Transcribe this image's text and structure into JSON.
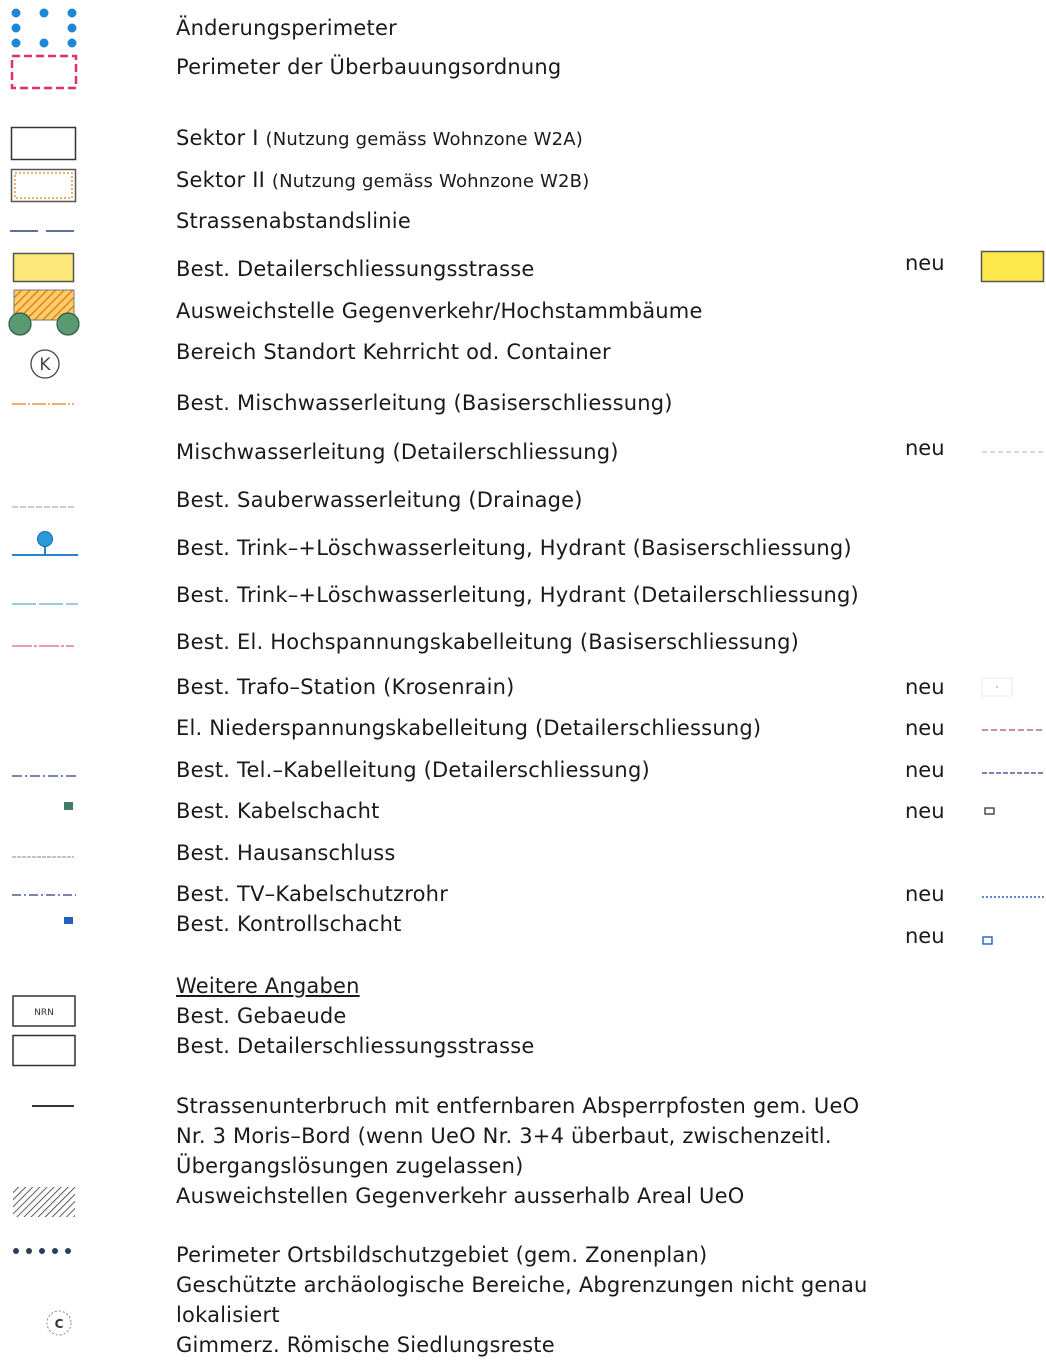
{
  "legend": {
    "items": [
      {
        "label": "Änderungsperimeter",
        "symbol": "blue-dots-icon"
      },
      {
        "label": "Perimeter der Überbauungsordnung",
        "symbol": "magenta-dashed-rect-icon"
      },
      {
        "label": "Sektor I",
        "note": "(Nutzung gemäss Wohnzone W2A)",
        "symbol": "white-rect-icon"
      },
      {
        "label": "Sektor II",
        "note": "(Nutzung gemäss Wohnzone W2B)",
        "symbol": "orange-outline-rect-icon"
      },
      {
        "label": "Strassenabstandslinie",
        "symbol": "navy-dash-line-icon"
      },
      {
        "label": "Best. Detailerschliessungsstrasse",
        "neu": "neu",
        "symbol": "yellow-rect-icon"
      },
      {
        "label": "Ausweichstelle Gegenverkehr/Hochstammbäume",
        "symbol": "hatched-with-trees-icon"
      },
      {
        "label": "Bereich Standort Kehrricht od. Container",
        "symbol": "k-circle-icon",
        "symbol_text": "K"
      },
      {
        "label": "Best. Mischwasserleitung (Basiserschliessung)",
        "symbol": "orange-line-icon"
      },
      {
        "label": "Mischwasserleitung (Detailerschliessung)",
        "neu": "neu",
        "symbol": "light-dash-line-icon"
      },
      {
        "label": "Best. Sauberwasserleitung (Drainage)",
        "symbol": "thin-dash-line-icon"
      },
      {
        "label": "Best. Trink–+Löschwasserleitung, Hydrant (Basiserschliessung)",
        "symbol": "hydrant-icon"
      },
      {
        "label": "Best. Trink–+Löschwasserleitung, Hydrant (Detailerschliessung)",
        "symbol": "light-blue-line-icon"
      },
      {
        "label": "Best. El. Hochspannungskabelleitung (Basiserschliessung)",
        "symbol": "pink-line-icon"
      },
      {
        "label": "Best. Trafo–Station (Krosenrain)",
        "neu": "neu",
        "symbol": "trafo-icon"
      },
      {
        "label": "El. Niederspannungskabelleitung (Detailerschliessung)",
        "neu": "neu",
        "symbol": "pink-dash-line-icon"
      },
      {
        "label": "Best. Tel.–Kabelleitung (Detailerschliessung)",
        "neu": "neu",
        "symbol": "navy-dashdot-line-icon"
      },
      {
        "label": "Best. Kabelschacht",
        "neu": "neu",
        "symbol": "teal-square-icon"
      },
      {
        "label": "Best. Hausanschluss",
        "symbol": "gray-dash-line-icon"
      },
      {
        "label": "Best. TV–Kabelschutzrohr",
        "neu": "neu",
        "symbol": "blue-dashdot-line-icon"
      },
      {
        "label": "Best. Kontrollschacht",
        "neu": "neu",
        "symbol": "blue-square-icon"
      }
    ],
    "weitere": {
      "heading": "Weitere Angaben",
      "gebaeude": "Best. Gebaeude",
      "gebaeude_symbol_text": "NRN",
      "strasse": "Best. Detailerschliessungsstrasse",
      "unterbruch": [
        "Strassenunterbruch mit entfernbaren Absperrpfosten gem. UeO",
        "Nr. 3 Moris–Bord (wenn UeO Nr. 3+4 überbaut, zwischenzeitl.",
        "Übergangslösungen zugelassen)"
      ],
      "ausweich": "Ausweichstellen Gegenverkehr ausserhalb Areal UeO",
      "ortsbild": "Perimeter Ortsbildschutzgebiet (gem. Zonenplan)",
      "archaeo": [
        "Geschützte archäologische Bereiche, Abgrenzungen nicht genau",
        "lokalisiert"
      ],
      "gimmerz": "Gimmerz. Römische Siedlungsreste",
      "gimmerz_symbol_text": "C"
    }
  },
  "colors": {
    "blue_dot": "#1e88d6",
    "magenta": "#e0306a",
    "navy": "#2b3f7a",
    "yellow": "#fce97a",
    "yellow_bright": "#fde84c",
    "orange": "#e8963c",
    "tree_green": "#5a9a72",
    "light_blue": "#7ab8e8",
    "pink": "#e07aa0",
    "teal": "#3f7a6a",
    "blue": "#2060c0"
  }
}
